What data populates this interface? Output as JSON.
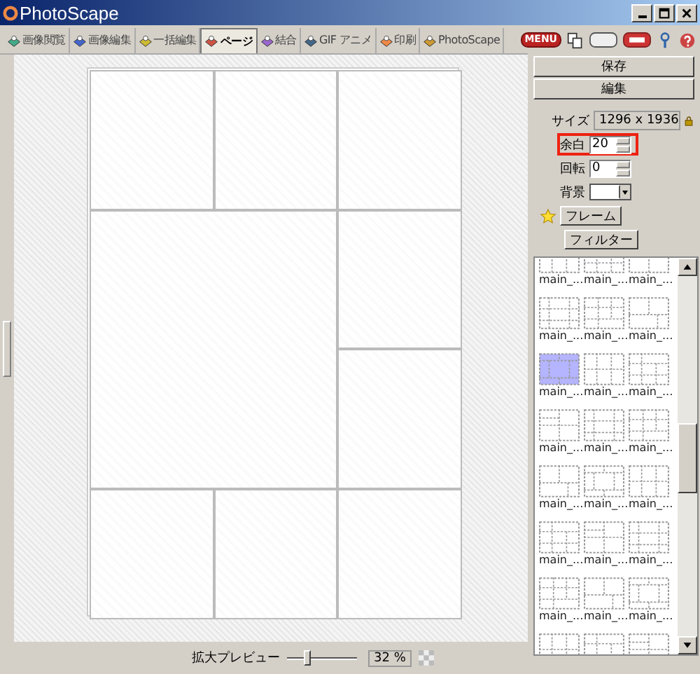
{
  "window": {
    "title": "PhotoScape"
  },
  "tabs": [
    {
      "label": "画像閲覧",
      "selected": false
    },
    {
      "label": "画像編集",
      "selected": false
    },
    {
      "label": "一括編集",
      "selected": false
    },
    {
      "label": "ページ",
      "selected": true
    },
    {
      "label": "結合",
      "selected": false
    },
    {
      "label": "GIF アニメ",
      "selected": false
    },
    {
      "label": "印刷",
      "selected": false
    },
    {
      "label": "PhotoScape",
      "selected": false
    }
  ],
  "toolbar": {
    "menu_button": "MENU"
  },
  "panel": {
    "save_button": "保存",
    "edit_button": "編集",
    "size": {
      "label": "サイズ",
      "value": "1296 x 1936"
    },
    "margin": {
      "label": "余白",
      "value": "20",
      "highlighted": true
    },
    "rotation": {
      "label": "回転",
      "value": "0",
      "highlighted": false
    },
    "background": {
      "label": "背景"
    },
    "frame_button": "フレーム",
    "filter_button": "フィルター"
  },
  "templates": [
    {
      "label": "main_...",
      "selected": false
    },
    {
      "label": "main_...",
      "selected": false
    },
    {
      "label": "main_...",
      "selected": false
    },
    {
      "label": "main_...",
      "selected": false
    },
    {
      "label": "main_...",
      "selected": false
    },
    {
      "label": "main_...",
      "selected": false
    },
    {
      "label": "main_...",
      "selected": true
    },
    {
      "label": "main_...",
      "selected": false
    },
    {
      "label": "main_...",
      "selected": false
    },
    {
      "label": "main_...",
      "selected": false
    },
    {
      "label": "main_...",
      "selected": false
    },
    {
      "label": "main_...",
      "selected": false
    },
    {
      "label": "main_...",
      "selected": false
    },
    {
      "label": "main_...",
      "selected": false
    },
    {
      "label": "main_...",
      "selected": false
    },
    {
      "label": "main_...",
      "selected": false
    },
    {
      "label": "main_...",
      "selected": false
    },
    {
      "label": "main_...",
      "selected": false
    },
    {
      "label": "main_...",
      "selected": false
    },
    {
      "label": "main_...",
      "selected": false
    },
    {
      "label": "main_...",
      "selected": false
    },
    {
      "selected": false
    },
    {
      "selected": false
    },
    {
      "selected": false
    }
  ],
  "status_bar": {
    "zoom_label": "拡大プレビュー",
    "level": 0.27,
    "zoom_value": "32 %"
  }
}
